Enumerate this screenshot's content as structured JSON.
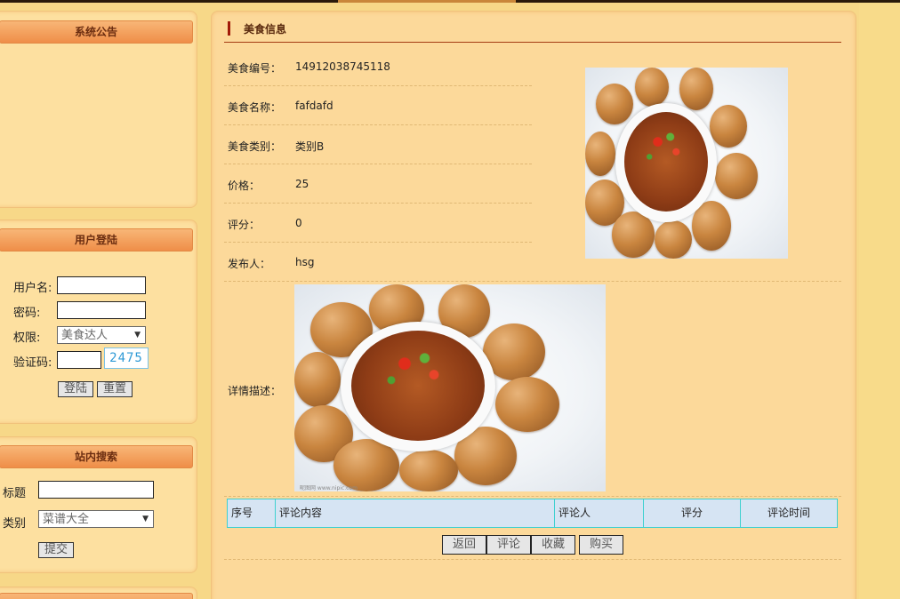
{
  "sidebar": {
    "notice": {
      "title": "系统公告"
    },
    "login": {
      "title": "用户登陆",
      "username_label": "用户名:",
      "password_label": "密码:",
      "role_label": "权限:",
      "role_value": "美食达人",
      "captcha_label": "验证码:",
      "captcha_code": "2475",
      "login_button": "登陆",
      "reset_button": "重置"
    },
    "search": {
      "title": "站内搜索",
      "title_label": "标题",
      "category_label": "类别",
      "category_value": "菜谱大全",
      "submit_button": "提交"
    }
  },
  "main": {
    "heading": "美食信息",
    "fields": [
      {
        "label": "美食编号：",
        "value": "14912038745118"
      },
      {
        "label": "美食名称：",
        "value": "fafdafd"
      },
      {
        "label": "美食类别：",
        "value": "类别B"
      },
      {
        "label": "价格：",
        "value": "25"
      },
      {
        "label": "评分：",
        "value": "0"
      },
      {
        "label": "发布人：",
        "value": "hsg"
      }
    ],
    "description_label": "详情描述：",
    "image_watermark": "昵图网 www.nipic.com",
    "comments_table": {
      "headers": [
        "序号",
        "评论内容",
        "评论人",
        "评分",
        "评论时间"
      ]
    },
    "actions": {
      "back": "返回",
      "comment": "评论",
      "favorite": "收藏",
      "buy": "购买"
    }
  },
  "colors": {
    "page_background": "#f7d888",
    "panel_title_gradient_start": "#f8b677",
    "panel_title_gradient_end": "#ef8e48",
    "heading_bar": "#a11a09",
    "table_header_background": "#d6e4f3",
    "table_border": "#3fd0d0"
  }
}
